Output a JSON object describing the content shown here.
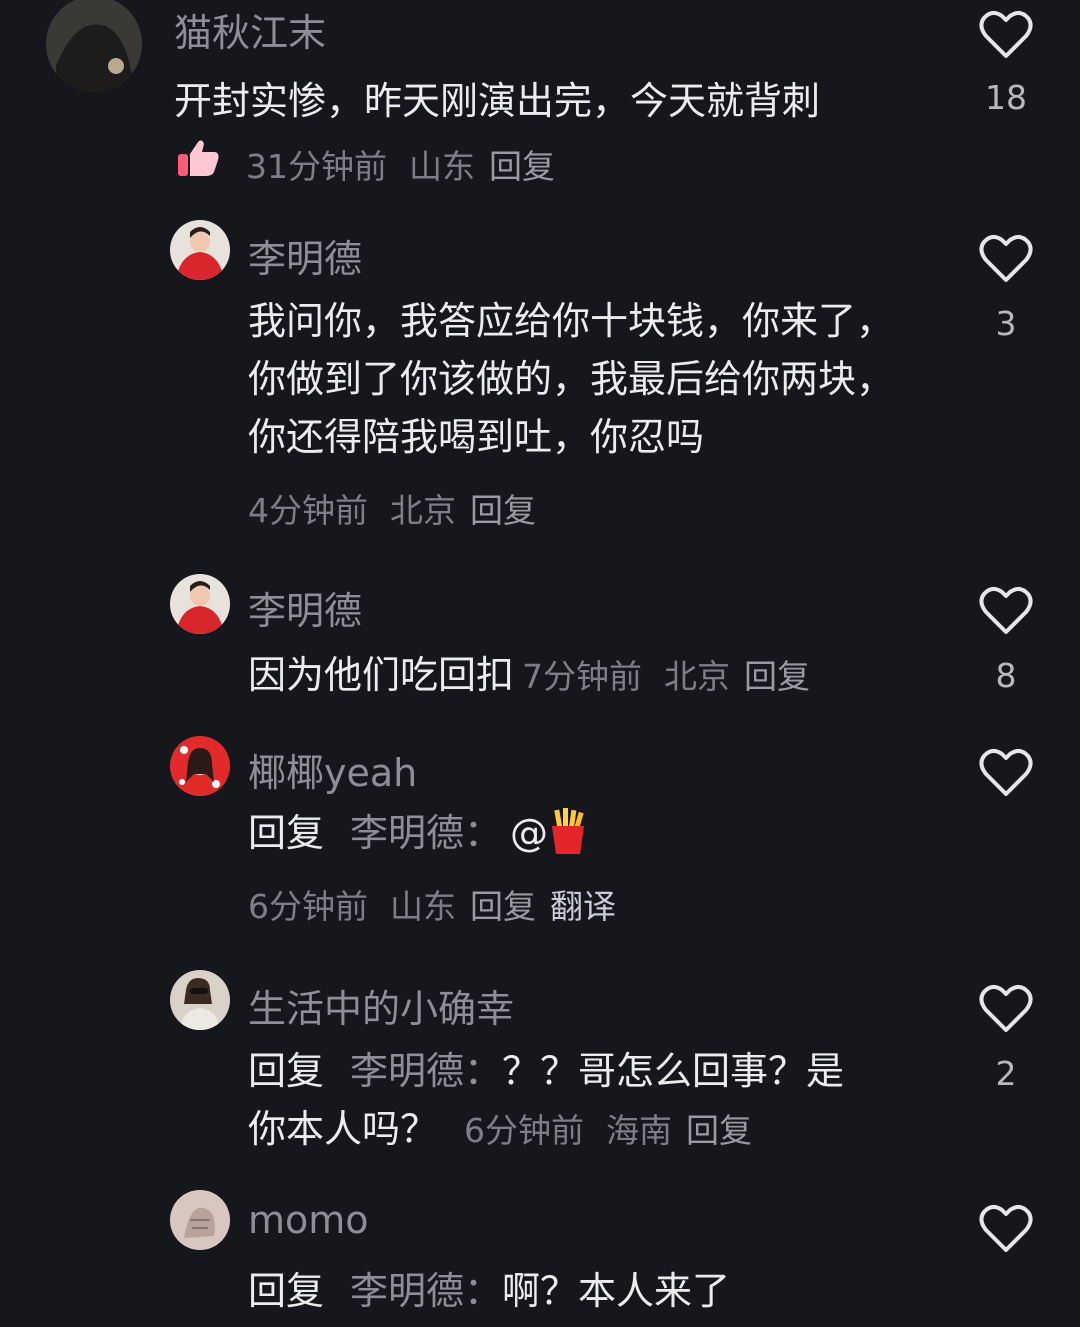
{
  "comments": [
    {
      "username": "猫秋江末",
      "text": "开封实惨，昨天刚演出完，今天就背刺",
      "time": "31分钟前",
      "location": "山东",
      "reply": "回复",
      "likes": "18",
      "avatar_icon": "user-avatar-dark"
    },
    {
      "username": "李明德",
      "lines": [
        "我问你，我答应给你十块钱，你来了，",
        "你做到了你该做的，我最后给你两块，",
        "你还得陪我喝到吐，你忍吗"
      ],
      "time": "4分钟前",
      "location": "北京",
      "reply": "回复",
      "likes": "3",
      "avatar_icon": "user-avatar-red-jacket"
    },
    {
      "username": "李明德",
      "text": "因为他们吃回扣",
      "time": "7分钟前",
      "location": "北京",
      "reply": "回复",
      "likes": "8",
      "avatar_icon": "user-avatar-red-jacket"
    },
    {
      "username": "椰椰yeah",
      "reply_prefix": "回复",
      "mention": "李明德：",
      "text": "@",
      "emoji_icon": "fries-icon",
      "time": "6分钟前",
      "location": "山东",
      "reply": "回复",
      "translate": "翻译",
      "likes": "",
      "avatar_icon": "user-avatar-red-hearts"
    },
    {
      "username": "生活中的小确幸",
      "reply_prefix": "回复",
      "mention": "李明德：",
      "line1": "？？哥怎么回事？是",
      "line2": "你本人吗？",
      "time": "6分钟前",
      "location": "海南",
      "reply": "回复",
      "likes": "2",
      "avatar_icon": "user-avatar-photo"
    },
    {
      "username": "momo",
      "reply_prefix": "回复",
      "mention": "李明德：",
      "text": "啊？本人来了",
      "likes": "",
      "avatar_icon": "user-avatar-sketch"
    }
  ],
  "colors": {
    "background": "#16171c",
    "username": "#8e8e96",
    "text": "#ececee",
    "meta": "#7e7e86",
    "heart_outline": "#e6e6ea",
    "thumb_icon": "#ff8fa3"
  },
  "icons": {
    "like": "heart-outline-icon",
    "reaction": "thumbs-up-icon"
  }
}
